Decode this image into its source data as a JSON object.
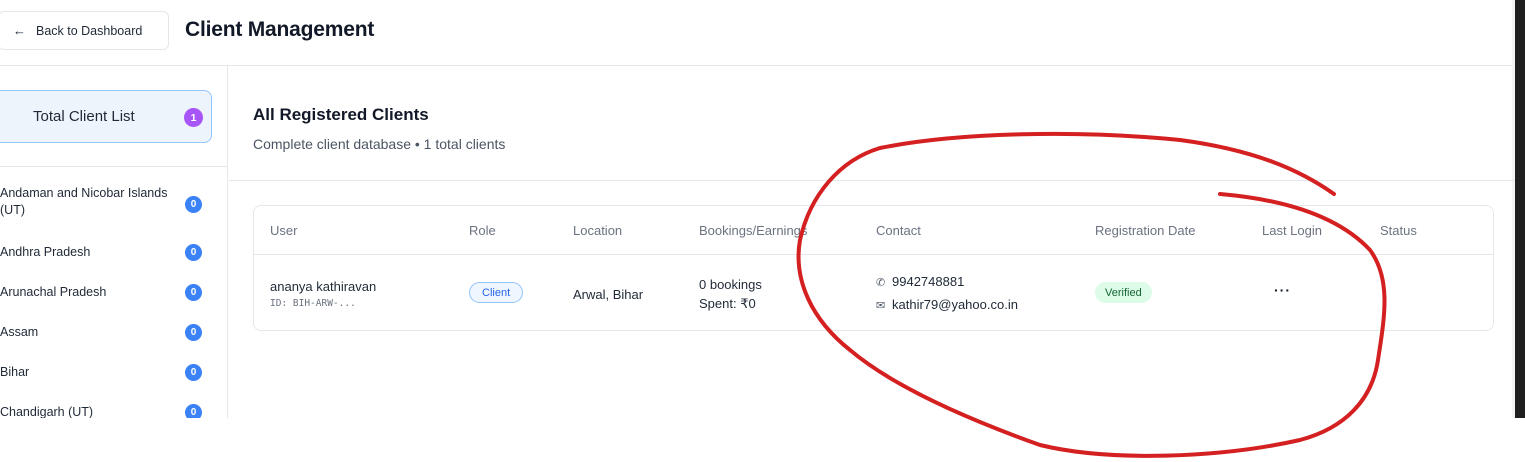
{
  "header": {
    "back_label": "Back to Dashboard",
    "title": "Client Management"
  },
  "sidebar": {
    "total": {
      "label": "Total Client List",
      "count": "1"
    },
    "states": [
      {
        "name": "Andaman and Nicobar Islands (UT)",
        "count": "0"
      },
      {
        "name": "Andhra Pradesh",
        "count": "0"
      },
      {
        "name": "Arunachal Pradesh",
        "count": "0"
      },
      {
        "name": "Assam",
        "count": "0"
      },
      {
        "name": "Bihar",
        "count": "0"
      },
      {
        "name": "Chandigarh (UT)",
        "count": "0"
      }
    ]
  },
  "main": {
    "title": "All Registered Clients",
    "subtitle": "Complete client database • 1 total clients"
  },
  "table": {
    "headers": [
      "User",
      "Role",
      "Location",
      "Bookings/Earnings",
      "Contact",
      "Registration Date",
      "Last Login",
      "Status"
    ],
    "row": {
      "name": "ananya kathiravan",
      "id": "ID: BIH-ARW-...",
      "role": "Client",
      "location": "Arwal, Bihar",
      "bookings": "0 bookings",
      "spent": "Spent: ₹0",
      "phone": "9942748881",
      "email": "kathir79@yahoo.co.in",
      "status": "Verified",
      "menu": "···"
    }
  },
  "colors": {
    "accent_blue": "#3b82f6",
    "badge_purple": "#a855f7",
    "verified_green": "#dcfce7",
    "annotation_red": "#d42020"
  },
  "icons": [
    "back-arrow-icon",
    "phone-icon",
    "mail-icon",
    "more-options-icon"
  ]
}
